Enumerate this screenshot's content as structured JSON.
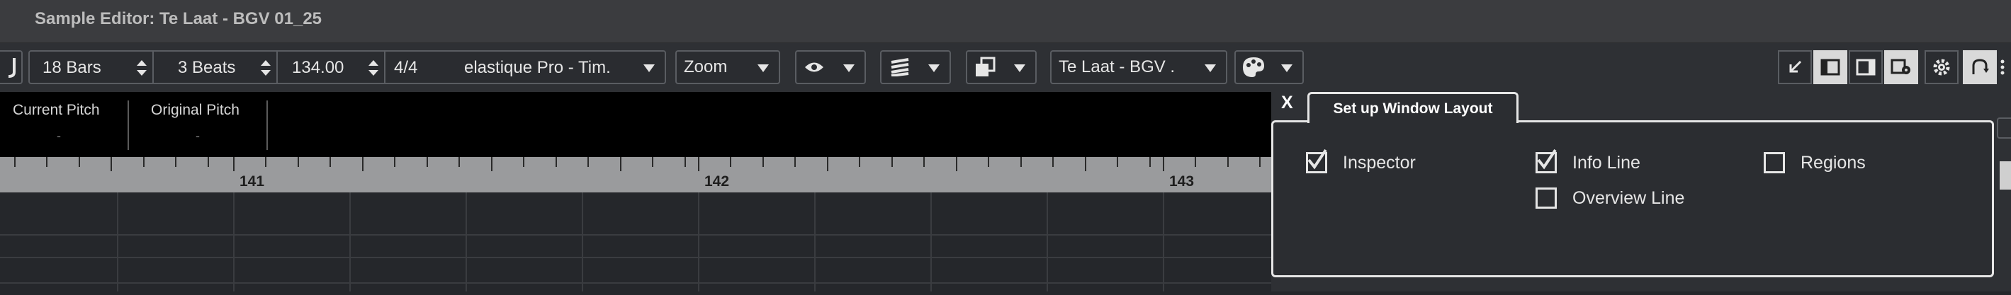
{
  "window": {
    "title": "Sample Editor: Te Laat - BGV 01_25"
  },
  "toolbar": {
    "bars": "18 Bars",
    "beats": "3 Beats",
    "tempo": "134.00",
    "signature": "4/4",
    "algorithm": "elastique Pro - Tim.",
    "zoom": "Zoom",
    "track": "Te Laat - BGV ."
  },
  "info": {
    "current_pitch_label": "Current Pitch",
    "current_pitch_value": "-",
    "original_pitch_label": "Original Pitch",
    "original_pitch_value": "-"
  },
  "ruler": {
    "labels": [
      "141",
      "142",
      "143"
    ]
  },
  "layout_panel": {
    "close": "X",
    "tab": "Set up Window Layout",
    "options": [
      {
        "label": "Inspector",
        "checked": true
      },
      {
        "label": "Info Line",
        "checked": true
      },
      {
        "label": "Overview Line",
        "checked": false
      },
      {
        "label": "Regions",
        "checked": false
      }
    ]
  },
  "colors": {
    "bg": "#25272b",
    "toolbar": "#2e3034",
    "ruler": "#9a9b9d",
    "panel_border": "#e6e6e6"
  }
}
